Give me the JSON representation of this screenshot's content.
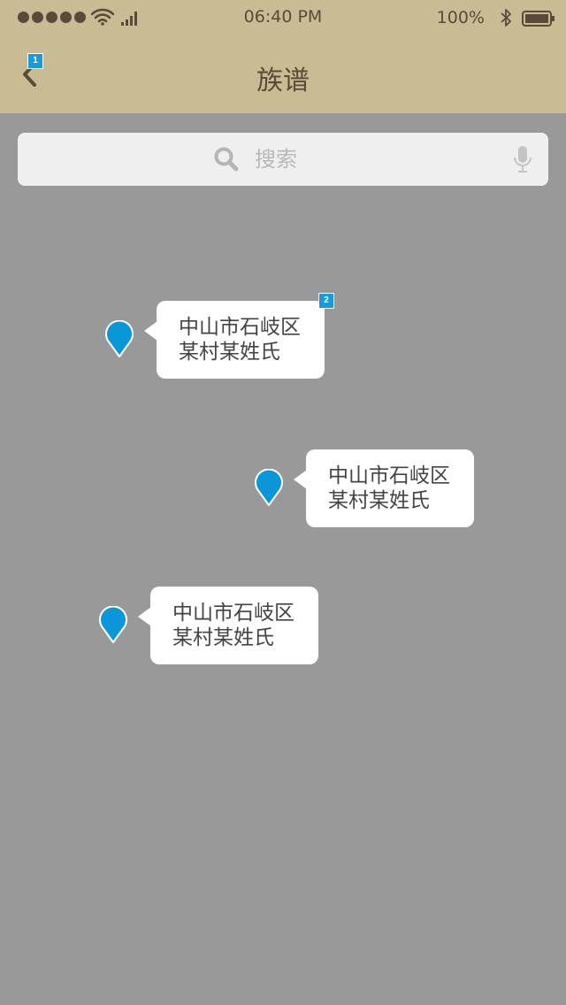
{
  "status_bar": {
    "time": "06:40 PM",
    "battery": "100%"
  },
  "nav": {
    "title": "族谱",
    "back_badge": "1"
  },
  "search": {
    "placeholder": "搜索"
  },
  "markers": [
    {
      "line1": "中山市石岐区",
      "line2": "某村某姓氏",
      "badge": "2"
    },
    {
      "line1": "中山市石岐区",
      "line2": "某村某姓氏"
    },
    {
      "line1": "中山市石岐区",
      "line2": "某村某姓氏"
    }
  ],
  "colors": {
    "header_bg": "#c8bc95",
    "header_text": "#5a4a3a",
    "map_bg": "#999999",
    "pin": "#0b96d8",
    "badge": "#1a9ad8"
  },
  "icons": [
    "back-icon",
    "wifi-icon",
    "cellular-icon",
    "bluetooth-icon",
    "battery-icon",
    "search-icon",
    "mic-icon",
    "map-pin-icon"
  ]
}
